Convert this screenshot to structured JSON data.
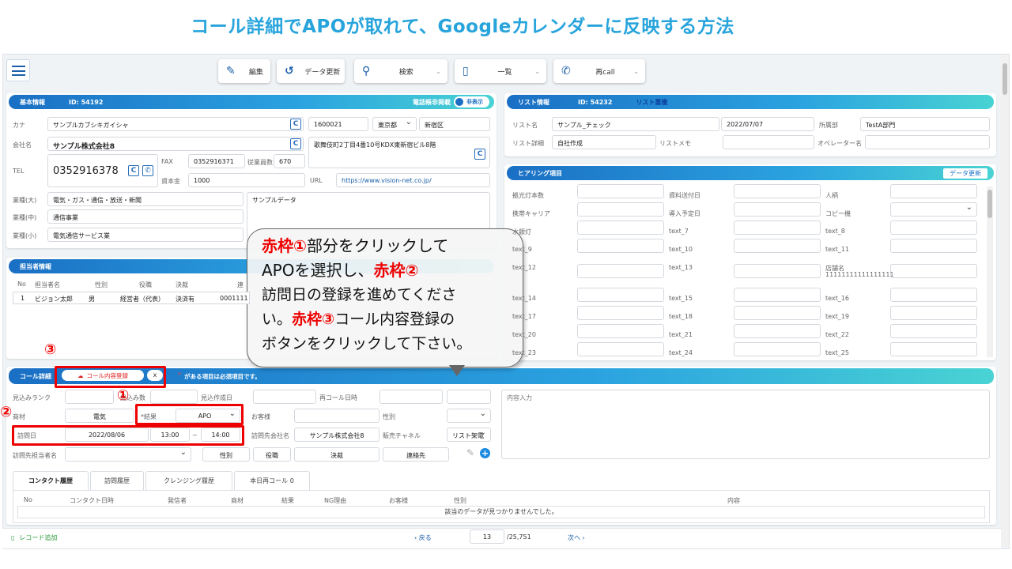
{
  "slide_title": "コール詳細でAPOが取れて、Googleカレンダーに反映する方法",
  "toolbar": {
    "edit": "編集",
    "refresh": "データ更新",
    "search": "検索",
    "list": "一覧",
    "recall": "再call"
  },
  "basic": {
    "title": "基本情報",
    "id": "ID: 54192",
    "phone_toggle_label": "電話帳非掲載",
    "toggle_text": "非表示",
    "kana_label": "カナ",
    "kana": "サンプルカブシキガイシャ",
    "zip": "1600021",
    "pref": "東京都",
    "city": "新宿区",
    "company_label": "会社名",
    "company": "サンプル株式会社8",
    "address": "歌舞伎町2丁目4番10号KDX東新宿ビル8階",
    "tel_label": "TEL",
    "tel": "0352916378",
    "fax_label": "FAX",
    "fax": "0352916371",
    "emp_label": "従業員数",
    "emp": "670",
    "capital_label": "資本金",
    "capital": "1000",
    "url_label": "URL",
    "url": "https://www.vision-net.co.jp/",
    "ind_l_label": "業種(大)",
    "ind_l": "電気・ガス・通信・放送・新聞",
    "ind_m_label": "業種(中)",
    "ind_m": "通信事業",
    "ind_s_label": "業種(小)",
    "ind_s": "電気通信サービス業",
    "memo": "サンプルデータ"
  },
  "list_info": {
    "title": "リスト情報",
    "id": "ID: 54232",
    "recheck": "リスト重複",
    "name_label": "リスト名",
    "name": "サンプル_チェック",
    "date": "2022/07/07",
    "dept_label": "所属部",
    "dept": "TestA部門",
    "detail_label": "リスト詳細",
    "detail": "自社作成",
    "memo_label": "リストメモ",
    "op_label": "オペレーター名"
  },
  "hearing": {
    "title": "ヒアリング項目",
    "update": "データ更新",
    "col1": [
      "拠光灯本数",
      "携帯キャリア",
      "水銀灯",
      "text_9",
      "text_12",
      "text_14",
      "text_17",
      "text_20",
      "text_23"
    ],
    "col2": [
      "資料送付日",
      "導入予定日",
      "text_7",
      "text_10",
      "text_13",
      "text_15",
      "text_18",
      "text_21",
      "text_24"
    ],
    "col3": [
      "人柄",
      "コピー機",
      "text_8",
      "text_11",
      "店舗名",
      "text_16",
      "text_19",
      "text_22",
      "text_25"
    ],
    "store_name": "11111111111111111"
  },
  "contact": {
    "title": "担当者情報",
    "headers": [
      "No",
      "担当者名",
      "性別",
      "役職",
      "決裁",
      "連"
    ],
    "row": [
      "1",
      "ビジョン太郎",
      "男",
      "経営者（代表）",
      "決済有",
      "0001111"
    ]
  },
  "callout": {
    "l1a": "赤枠①",
    "l1b": "部分をクリックして",
    "l2a": "APOを選択し、",
    "l2b": "赤枠②",
    "l3": "訪問日の登録を進めてくださ",
    "l4a": "い。",
    "l4b": "赤枠③",
    "l4c": "コール内容登録の",
    "l5": "ボタンをクリックして下さい。"
  },
  "marks": {
    "m1": "①",
    "m2": "②",
    "m3": "③"
  },
  "call": {
    "title": "コール詳細",
    "register": "コール内容登録",
    "close": "x",
    "required_note": "がある項目は必須項目です。",
    "required_mark": "*",
    "rank_label": "見込みランク",
    "count_label": "見込み数",
    "created_label": "見込作成日",
    "recall_label": "再コール日時",
    "goods_label": "商材",
    "goods": "電気",
    "result_label": "*結果",
    "result": "APO",
    "customer_label": "お客様",
    "gender_label": "性別",
    "visit_label": "訪問日",
    "visit_date": "2022/08/06",
    "time_from": "13:00",
    "tilde": "~",
    "time_to": "14:00",
    "visit_company_label": "訪問先会社名",
    "visit_company": "サンプル株式会社8",
    "channel_label": "販売チャネル",
    "channel": "リスト架電",
    "visit_person_label": "訪問先担当者名",
    "btn_gender": "性別",
    "btn_role": "役職",
    "btn_decision": "決裁",
    "btn_contact": "連絡先",
    "content_label": "内容入力"
  },
  "history": {
    "tabs": [
      "コンタクト履歴",
      "訪問履歴",
      "クレンジング履歴",
      "本日再コール 0"
    ],
    "headers": [
      "No",
      "コンタクト日時",
      "発信者",
      "商材",
      "結果",
      "NG理由",
      "お客様",
      "性別",
      "内容"
    ],
    "empty": "該当のデータが見つかりませんでした。"
  },
  "footer": {
    "add": "レコード追加",
    "prev": "戻る",
    "page": "13",
    "total": "/25,751",
    "next": "次へ"
  }
}
